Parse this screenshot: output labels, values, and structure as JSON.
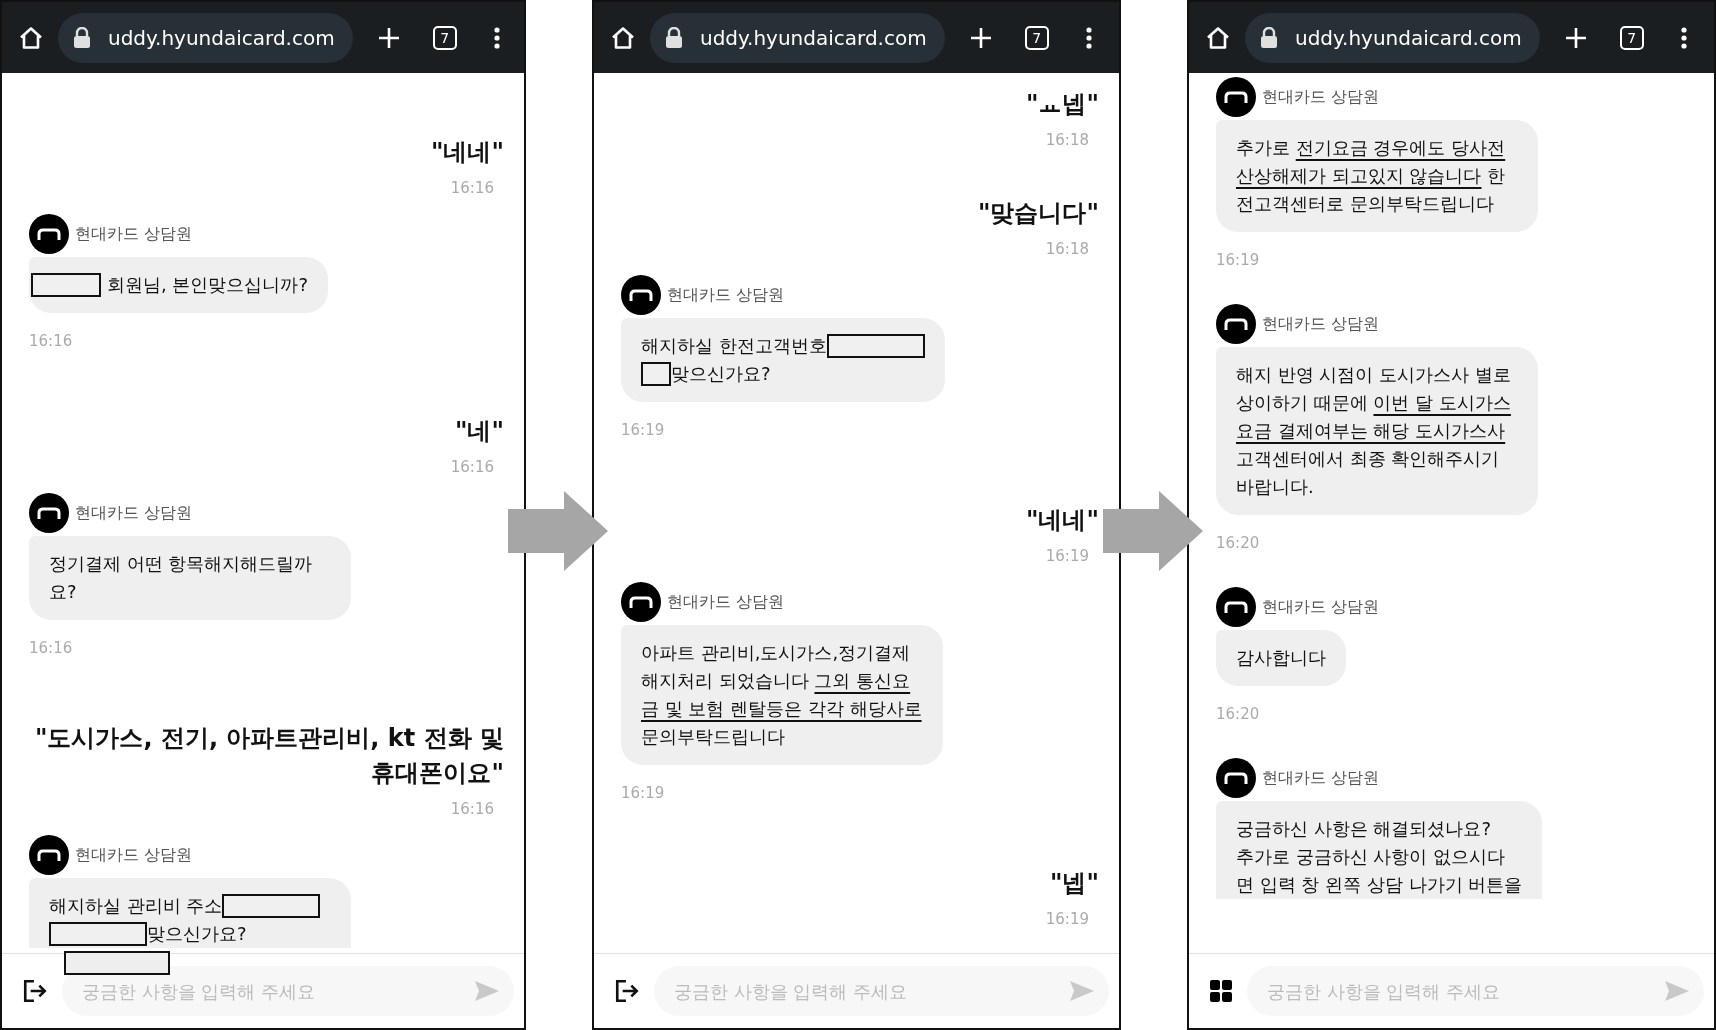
{
  "screens": [
    {
      "browser": {
        "url": "uddy.hyundaicard.com",
        "tab_count": "7"
      },
      "messages": [
        {
          "kind": "user",
          "text": "\"네네\"",
          "time": "16:16"
        },
        {
          "kind": "agent",
          "name": "현대카드 상담원",
          "lines": [
            [
              {
                "kind": "mask_m"
              },
              {
                "kind": "text",
                "text": "회원님, 본인맞으십니까?"
              }
            ]
          ],
          "time": "16:16",
          "cut": false
        },
        {
          "kind": "user",
          "text": "\"네\"",
          "time": "16:16"
        },
        {
          "kind": "agent",
          "name": "현대카드 상담원",
          "lines": [
            [
              {
                "kind": "text",
                "text": "정기결제 어떤 항목해지해드릴까"
              }
            ],
            [
              {
                "kind": "text",
                "text": "요?"
              }
            ]
          ],
          "time": "16:16",
          "cut": false
        },
        {
          "kind": "user",
          "text": "\"도시가스, 전기, 아파트관리비, kt 전화 및 휴대폰이요\"",
          "time": "16:16"
        },
        {
          "kind": "agent",
          "name": "현대카드 상담원",
          "lines": [
            [
              {
                "kind": "text",
                "text": "해지하실 관리비 주소"
              },
              {
                "kind": "mask_l"
              }
            ],
            [
              {
                "kind": "mask_l"
              },
              {
                "kind": "text",
                "text": "맞으신가요?"
              }
            ]
          ],
          "cut": true
        }
      ],
      "redaction_overlay": true,
      "input": {
        "left_button": {
          "kind": "exit"
        },
        "placeholder": "궁금한 사항을 입력해 주세요"
      }
    },
    {
      "browser": {
        "url": "uddy.hyundaicard.com",
        "tab_count": "7"
      },
      "messages": [
        {
          "kind": "user",
          "text": "\"ㅛ넵\"",
          "time": "16:18"
        },
        {
          "kind": "user",
          "text": "\"맞습니다\"",
          "time": "16:18"
        },
        {
          "kind": "agent",
          "name": "현대카드 상담원",
          "lines": [
            [
              {
                "kind": "text",
                "text": "해지하실 한전고객번호"
              },
              {
                "kind": "mask_l"
              }
            ],
            [
              {
                "kind": "mask_s"
              },
              {
                "kind": "text",
                "text": "맞으신가요?"
              }
            ]
          ],
          "time": "16:19",
          "cut": false
        },
        {
          "kind": "user",
          "text": "\"네네\"",
          "time": "16:19"
        },
        {
          "kind": "agent",
          "name": "현대카드 상담원",
          "lines": [
            [
              {
                "kind": "text",
                "text": "아파트 관리비,도시가스,정기결제"
              }
            ],
            [
              {
                "kind": "text",
                "text": "해지처리 되었습니다 "
              },
              {
                "kind": "underlined",
                "text": "그외 통신요"
              }
            ],
            [
              {
                "kind": "underlined",
                "text": "금 및 보험 렌탈등은 각각 해당사로"
              }
            ],
            [
              {
                "kind": "text",
                "text": "문의부탁드립니다"
              }
            ]
          ],
          "time": "16:19",
          "cut": false
        },
        {
          "kind": "user",
          "text": "\"넵\"",
          "time": "16:19"
        }
      ],
      "redaction_overlay": false,
      "input": {
        "left_button": {
          "kind": "exit"
        },
        "placeholder": "궁금한 사항을 입력해 주세요"
      }
    },
    {
      "browser": {
        "url": "uddy.hyundaicard.com",
        "tab_count": "7"
      },
      "messages": [
        {
          "kind": "agent",
          "name": "현대카드 상담원",
          "lines": [
            [
              {
                "kind": "text",
                "text": "추가로 "
              },
              {
                "kind": "underlined",
                "text": "전기요금 경우에도 당사전"
              }
            ],
            [
              {
                "kind": "underlined",
                "text": "산상해제가 되고있지 않습니다"
              },
              {
                "kind": "text",
                "text": " 한"
              }
            ],
            [
              {
                "kind": "text",
                "text": "전고객센터로 문의부탁드립니다"
              }
            ]
          ],
          "time": "16:19",
          "cut": false
        },
        {
          "kind": "agent",
          "name": "현대카드 상담원",
          "lines": [
            [
              {
                "kind": "text",
                "text": "해지 반영 시점이 도시가스사 별로"
              }
            ],
            [
              {
                "kind": "text",
                "text": "상이하기 때문에 "
              },
              {
                "kind": "underlined",
                "text": "이번 달 도시가스"
              }
            ],
            [
              {
                "kind": "underlined",
                "text": "요금 결제여부는 해당 도시가스사"
              }
            ],
            [
              {
                "kind": "text",
                "text": "고객센터에서 최종 확인해주시기"
              }
            ],
            [
              {
                "kind": "text",
                "text": "바랍니다."
              }
            ]
          ],
          "time": "16:20",
          "cut": false
        },
        {
          "kind": "agent",
          "name": "현대카드 상담원",
          "lines": [
            [
              {
                "kind": "text",
                "text": "감사합니다"
              }
            ]
          ],
          "time": "16:20",
          "cut": false
        },
        {
          "kind": "agent",
          "name": "현대카드 상담원",
          "lines": [
            [
              {
                "kind": "text",
                "text": "궁금하신 사항은 해결되셨나요?"
              }
            ],
            [
              {
                "kind": "text",
                "text": "추가로 궁금하신 사항이 없으시다"
              }
            ],
            [
              {
                "kind": "text",
                "text": "면 입력 창 왼쪽 상담 나가기 버튼을"
              }
            ]
          ],
          "cut": true
        }
      ],
      "redaction_overlay": false,
      "input": {
        "left_button": {
          "kind": "menu"
        },
        "placeholder": "궁금한 사항을 입력해 주세요"
      }
    }
  ]
}
